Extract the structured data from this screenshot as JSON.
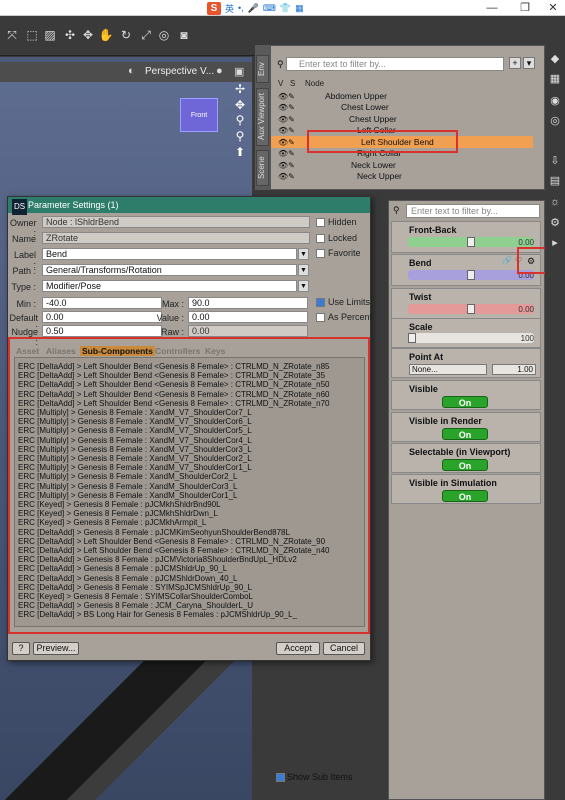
{
  "titlebar": {
    "ime_logo": "S",
    "ime_label": "英",
    "minimize": "—",
    "restore": "❐",
    "close": "✕"
  },
  "viewport": {
    "camera": "Perspective V...",
    "cube_label": "Front"
  },
  "scene": {
    "vertical_tabs": [
      "Scene",
      "Aux Viewport",
      "Env"
    ],
    "filter_placeholder": "Enter text to filter by...",
    "columns": {
      "v": "V",
      "s": "S",
      "node": "Node"
    },
    "rows": [
      "Abdomen Upper",
      "Chest Lower",
      "Chest Upper",
      "Left Collar",
      "Left Shoulder Bend",
      "Right Collar",
      "Neck Lower",
      "Neck Upper"
    ],
    "selected": "Left Shoulder Bend"
  },
  "params": {
    "filter_placeholder": "Enter text to filter by...",
    "front_back": {
      "label": "Front-Back",
      "value": "0.00",
      "level": 0.5
    },
    "bend": {
      "label": "Bend",
      "value": "0.00",
      "level": 0.5
    },
    "twist": {
      "label": "Twist",
      "value": "0.00",
      "level": 0.5
    },
    "scale": {
      "label": "Scale",
      "value": "100",
      "level": 0.0
    },
    "point_at": {
      "label": "Point At",
      "value": "None...",
      "value2": "1.00"
    },
    "visible": {
      "label": "Visible",
      "state": "On"
    },
    "visible_in_render": {
      "label": "Visible in Render",
      "state": "On"
    },
    "selectable": {
      "label": "Selectable (in Viewport)",
      "state": "On"
    },
    "visible_sim": {
      "label": "Visible in Simulation",
      "state": "On"
    },
    "show_sub_items": "Show Sub Items"
  },
  "dialog": {
    "title": "Parameter Settings (1)",
    "ds_badge": "DS",
    "owner_label": "Owner :",
    "owner": "Node : lShldrBend",
    "name_label": "Name",
    "name": "ZRotate",
    "label_label": "Label :",
    "label": "Bend",
    "path_label": "Path :",
    "path": "General/Transforms/Rotation",
    "type_label": "Type :",
    "type": "Modifier/Pose",
    "hidden": "Hidden",
    "locked": "Locked",
    "favorite": "Favorite",
    "min_label": "Min :",
    "min": "-40.0",
    "max_label": "Max :",
    "max": "90.0",
    "default_label": "Default :",
    "default": "0.00",
    "value_label": "Value :",
    "value": "0.00",
    "nudge_label": "Nudge :",
    "nudge": "0.50",
    "raw_label": "Raw :",
    "raw": "0.00",
    "use_limits": "Use Limits",
    "as_percent": "As Percent",
    "tabs": [
      "Asset",
      "Aliases",
      "Sub-Components",
      "Controllers",
      "Keys"
    ],
    "active_tab": "Sub-Components",
    "sub_components": [
      "ERC [DeltaAdd] > Left Shoulder Bend <Genesis 8 Female> : CTRLMD_N_ZRotate_n85",
      "ERC [DeltaAdd] > Left Shoulder Bend <Genesis 8 Female> : CTRLMD_N_ZRotate_35",
      "ERC [DeltaAdd] > Left Shoulder Bend <Genesis 8 Female> : CTRLMD_N_ZRotate_n50",
      "ERC [DeltaAdd] > Left Shoulder Bend <Genesis 8 Female> : CTRLMD_N_ZRotate_n60",
      "ERC [DeltaAdd] > Left Shoulder Bend <Genesis 8 Female> : CTRLMD_N_ZRotate_n70",
      "ERC [Multiply] > Genesis 8 Female : XandM_V7_ShoulderCor7_L",
      "ERC [Multiply] > Genesis 8 Female : XandM_V7_ShoulderCor6_L",
      "ERC [Multiply] > Genesis 8 Female : XandM_V7_ShoulderCor5_L",
      "ERC [Multiply] > Genesis 8 Female : XandM_V7_ShoulderCor4_L",
      "ERC [Multiply] > Genesis 8 Female : XandM_V7_ShoulderCor3_L",
      "ERC [Multiply] > Genesis 8 Female : XandM_V7_ShoulderCor2_L",
      "ERC [Multiply] > Genesis 8 Female : XandM_V7_ShoulderCor1_L",
      "ERC [Multiply] > Genesis 8 Female : XandM_ShoulderCor2_L",
      "ERC [Multiply] > Genesis 8 Female : XandM_ShoulderCor3_L",
      "ERC [Multiply] > Genesis 8 Female : XandM_ShoulderCor1_L",
      "ERC [Keyed] > Genesis 8 Female : pJCMkhShldrBnd90L",
      "ERC [Keyed] > Genesis 8 Female : pJCMkhShldrDwn_L",
      "ERC [Keyed] > Genesis 8 Female : pJCMkhArmpit_L",
      "ERC [DeltaAdd] > Genesis 8 Female : pJCMKimSeohyunShoulderBend878L",
      "ERC [DeltaAdd] > Left Shoulder Bend <Genesis 8 Female> : CTRLMD_N_ZRotate_90",
      "ERC [DeltaAdd] > Left Shoulder Bend <Genesis 8 Female> : CTRLMD_N_ZRotate_n40",
      "ERC [DeltaAdd] > Genesis 8 Female : pJCMVictoria8ShoulderBndUpL_HDLv2",
      "ERC [DeltaAdd] > Genesis 8 Female : pJCMShldrUp_90_L",
      "ERC [DeltaAdd] > Genesis 8 Female : pJCMShldrDown_40_L",
      "ERC [DeltaAdd] > Genesis 8 Female : SYIMSpJCMShldrUp_90_L",
      "ERC [Keyed] > Genesis 8 Female : SYIMSCollarShoulderComboL",
      "ERC [DeltaAdd] > Genesis 8 Female : JCM_Caryna_ShoulderL_U",
      "ERC [DeltaAdd] > BS Long Hair for Genesis 8 Females : pJCMShldrUp_90_L_"
    ],
    "help": "?",
    "preview": "Preview...",
    "accept": "Accept",
    "cancel": "Cancel"
  },
  "colors": {
    "selection": "#f0a050",
    "dialog_title": "#2e7d6b",
    "toggle_on": "#2aa32a",
    "highlight_box": "#d9312b"
  }
}
